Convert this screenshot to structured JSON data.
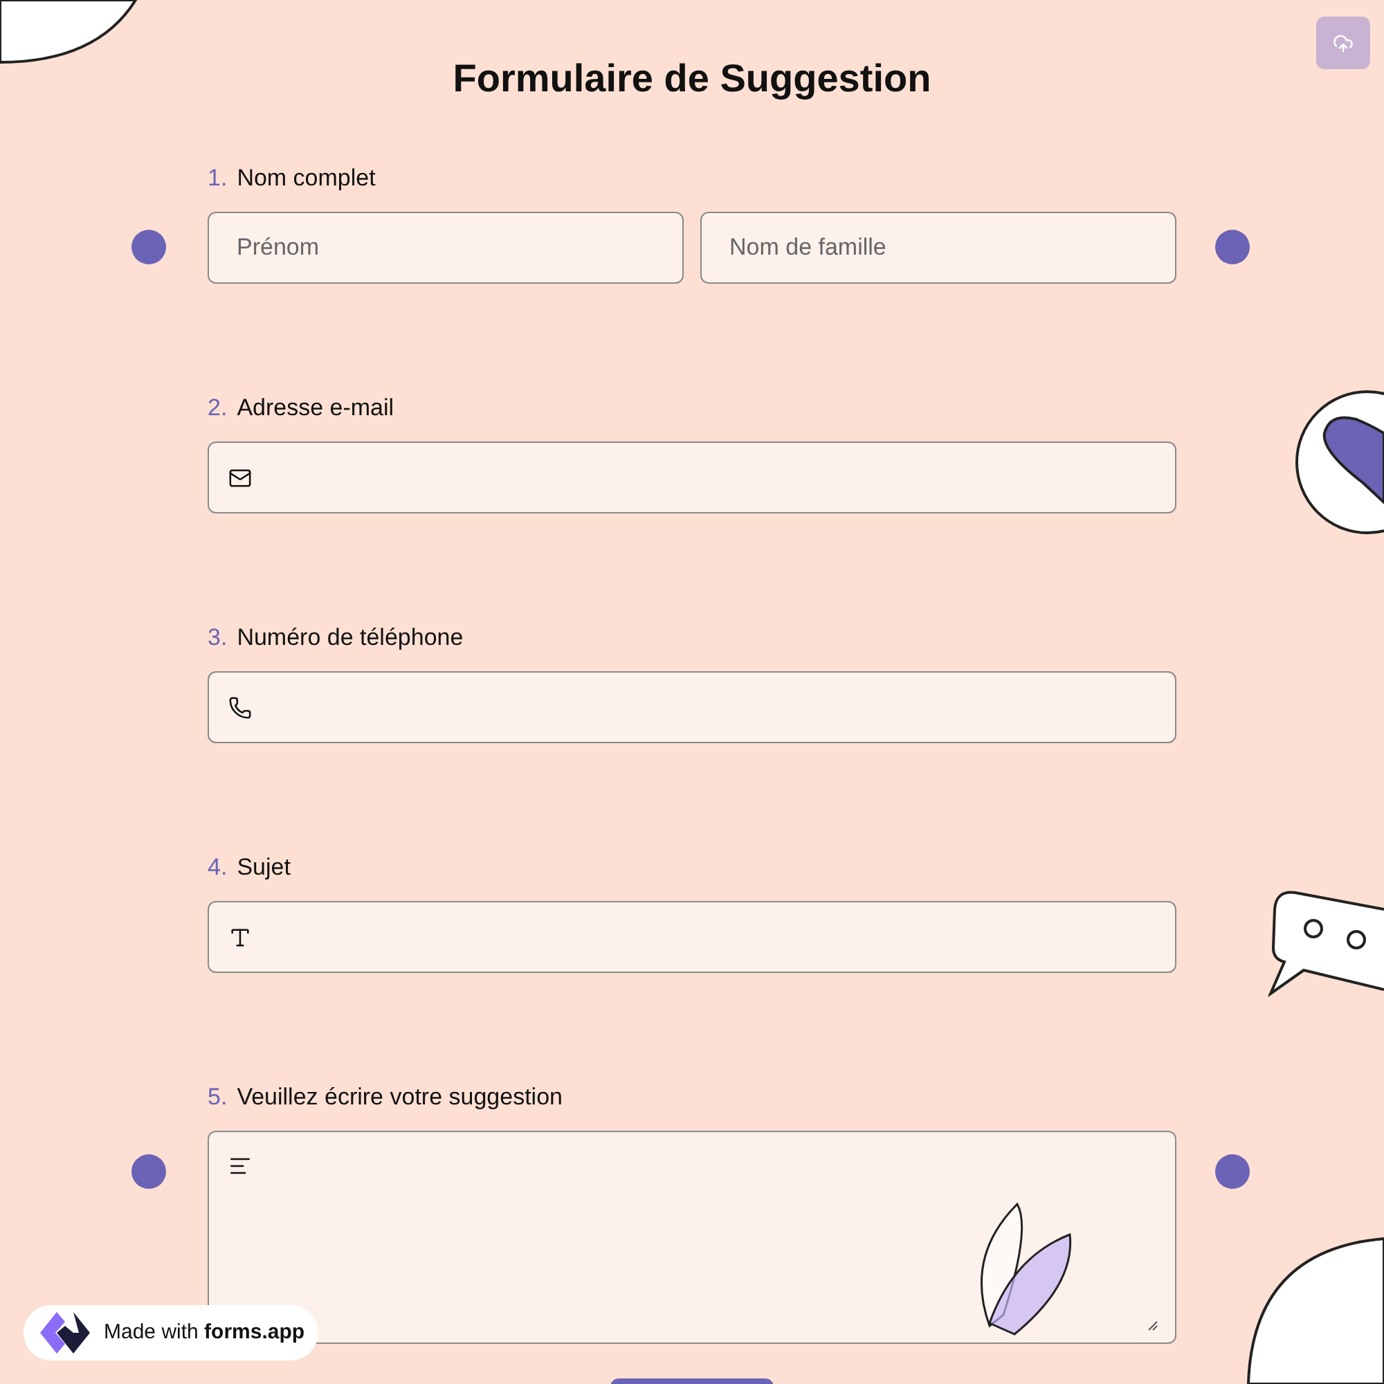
{
  "title": "Formulaire de Suggestion",
  "questions": [
    {
      "number": "1.",
      "label": "Nom complet",
      "kind": "name",
      "fields": [
        {
          "placeholder": "Prénom"
        },
        {
          "placeholder": "Nom de famille"
        }
      ]
    },
    {
      "number": "2.",
      "label": "Adresse e-mail",
      "kind": "email"
    },
    {
      "number": "3.",
      "label": "Numéro de téléphone",
      "kind": "phone"
    },
    {
      "number": "4.",
      "label": "Sujet",
      "kind": "text"
    },
    {
      "number": "5.",
      "label": "Veuillez écrire votre suggestion",
      "kind": "textarea"
    }
  ],
  "badge": "Made with **forms.app**"
}
